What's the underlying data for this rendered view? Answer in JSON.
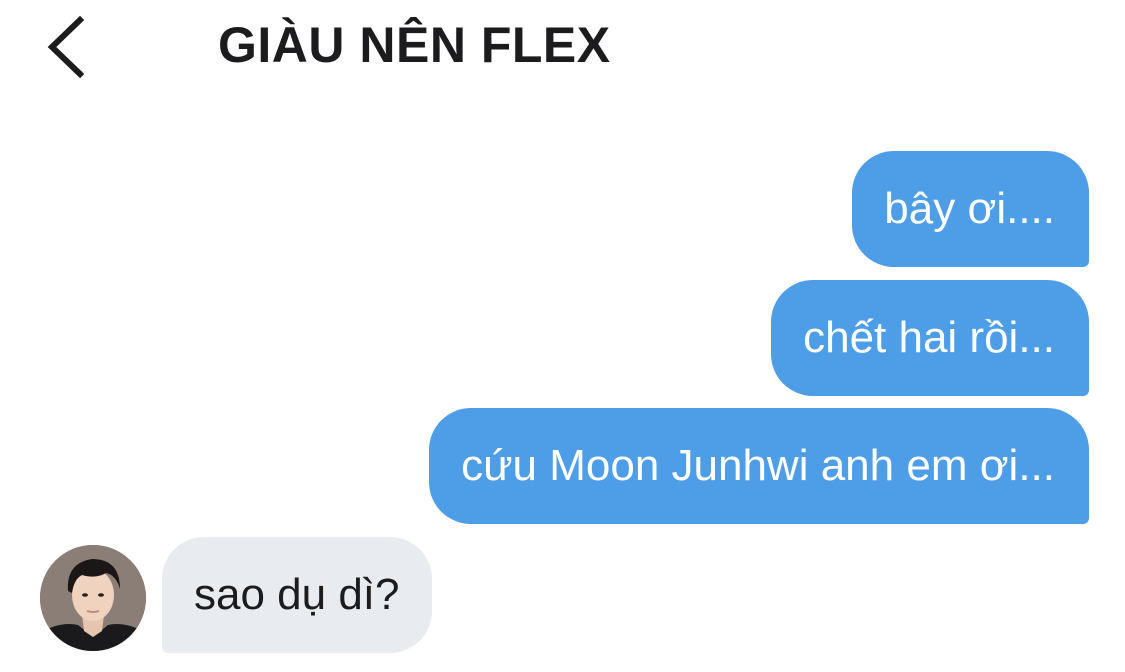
{
  "header": {
    "back_icon": "chevron-left-icon",
    "title": "GIÀU NÊN FLEX"
  },
  "messages": [
    {
      "direction": "outgoing",
      "text": "bây ơi...."
    },
    {
      "direction": "outgoing",
      "text": "chết hai rồi..."
    },
    {
      "direction": "outgoing",
      "text": "cứu Moon Junhwi anh em ơi..."
    },
    {
      "direction": "incoming",
      "text": "sao dụ dì?"
    }
  ],
  "colors": {
    "outgoing_bubble": "#4d9de7",
    "incoming_bubble": "#e8ebef",
    "title_text": "#1c1c1e"
  }
}
